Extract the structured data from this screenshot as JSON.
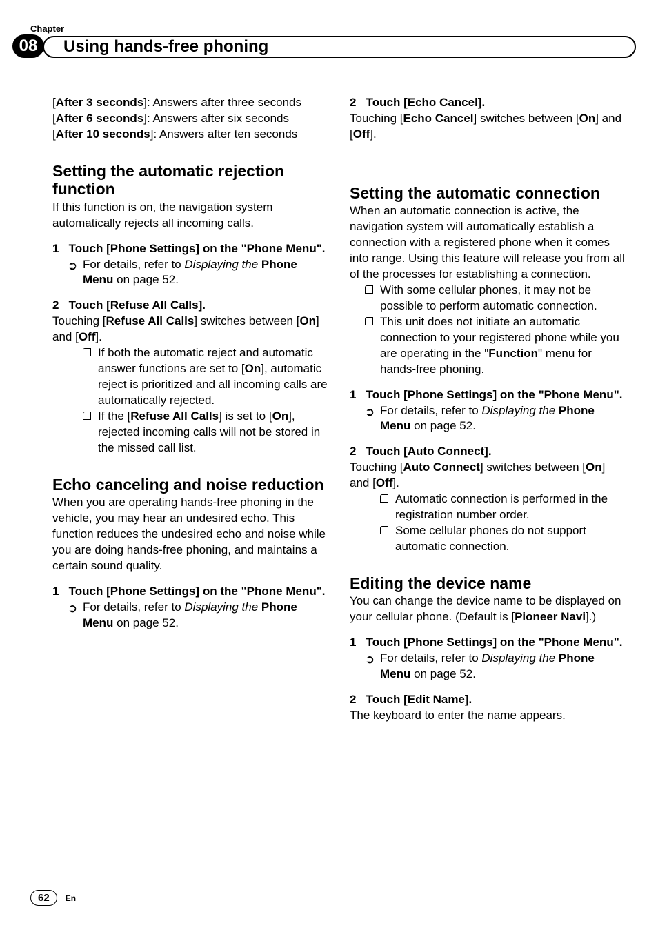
{
  "chapterLabel": "Chapter",
  "chapterNum": "08",
  "pageTitle": "Using hands-free phoning",
  "pageNum": "62",
  "lang": "En",
  "left": {
    "after3_label": "After 3 seconds",
    "after3_text": "]: Answers after three seconds",
    "after6_label": "After 6 seconds",
    "after6_text": "]: Answers after six seconds",
    "after10_label": "After 10 seconds",
    "after10_text": "]: Answers after ten seconds",
    "rejection_h": "Setting the automatic rejection function",
    "rejection_p": "If this function is on, the navigation system automatically rejects all incoming calls.",
    "step1_num": "1",
    "step1_text": "Touch [Phone Settings] on the \"Phone Menu\".",
    "details_prefix": "For details, refer to ",
    "details_italic": "Displaying the",
    "phone_menu": "Phone Menu",
    "on_page": " on page 52.",
    "step2_num": "2",
    "step2_rej": "Touch [Refuse All Calls].",
    "rej_t1": "Touching [",
    "rej_b1": "Refuse All Calls",
    "rej_t2": "] switches between [",
    "on": "On",
    "rej_t3": "] and [",
    "off": "Off",
    "rej_t4": "].",
    "rej_b_a1": "If both the automatic reject and automatic answer functions are set to [",
    "rej_b_a2": "], automatic reject is prioritized and all incoming calls are automatically rejected.",
    "rej_b_b1": "If the [",
    "rej_b_b2": "] is set to [",
    "rej_b_b3": "], rejected incoming calls will not be stored in the missed call list.",
    "echo_h": "Echo canceling and noise reduction",
    "echo_p": "When you are operating hands-free phoning in the vehicle, you may hear an undesired echo. This function reduces the undesired echo and noise while you are doing hands-free phoning, and maintains a certain sound quality.",
    "step2_echo": "Touch [Echo Cancel].",
    "echo_t1": "Touching [",
    "echo_b1": "Echo Cancel",
    "echo_t2": "] switches between ["
  },
  "right": {
    "auto_h": "Setting the automatic connection",
    "auto_p": "When an automatic connection is active, the navigation system will automatically establish a connection with a registered phone when it comes into range. Using this feature will release you from all of the processes for establishing a connection.",
    "auto_b1": "With some cellular phones, it may not be possible to perform automatic connection.",
    "auto_b2a": "This unit does not initiate an automatic connection to your registered phone while you are operating in the \"",
    "auto_b2b": "Function",
    "auto_b2c": "\" menu for hands-free phoning.",
    "step2_auto": "Touch [Auto Connect].",
    "auto_t1": "Touching [",
    "auto_bold": "Auto Connect",
    "auto_t2": "] switches between [",
    "auto_t3": "] and [",
    "auto_t4": "].",
    "auto_sb1": "Automatic connection is performed in the registration number order.",
    "auto_sb2": "Some cellular phones do not support automatic connection.",
    "edit_h": "Editing the device name",
    "edit_p1": "You can change the device name to be displayed on your cellular phone. (Default is [",
    "edit_b": "Pioneer Navi",
    "edit_p2": "].)",
    "step2_edit": "Touch [Edit Name].",
    "edit_after": "The keyboard to enter the name appears."
  }
}
